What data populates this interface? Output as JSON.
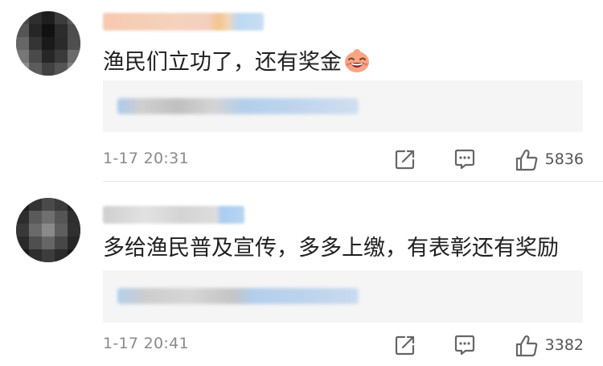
{
  "comments": [
    {
      "text": "渔民们立功了，还有奖金",
      "reply_summary": "共70条回复",
      "time": "1-17 20:31",
      "likes": "5836",
      "has_emoji": true,
      "avatar_tones": [
        "#4a4a4a",
        "#2e2e2e",
        "#1e1e1e",
        "#3c3c3c",
        "#5a5a5a",
        "#555555",
        "#262626",
        "#111111",
        "#2c2c2c",
        "#4d4d4d",
        "#666666",
        "#343434",
        "#1a1a1a",
        "#2a2a2a",
        "#4f4f4f",
        "#777777",
        "#4a4a4a",
        "#262626",
        "#3a3a3a",
        "#6a6a6a",
        "#8c8c8c",
        "#5c5c5c",
        "#414141",
        "#555555",
        "#7e7e7e"
      ]
    },
    {
      "text": "多给渔民普及宣传，多多上缴，有表彰还有奖励",
      "reply_summary": "",
      "time": "1-17 20:41",
      "likes": "3382",
      "has_emoji": false,
      "avatar_tones": [
        "#1f1f1f",
        "#333333",
        "#4a4a4a",
        "#3a3a3a",
        "#222222",
        "#2d2d2d",
        "#5a5a5a",
        "#6f6f6f",
        "#555555",
        "#2e2e2e",
        "#383838",
        "#6a6a6a",
        "#8a8a8a",
        "#5e5e5e",
        "#303030",
        "#2a2a2a",
        "#4f4f4f",
        "#666666",
        "#474747",
        "#272727",
        "#1c1c1c",
        "#2e2e2e",
        "#3d3d3d",
        "#2b2b2b",
        "#1a1a1a"
      ]
    }
  ],
  "icons": {
    "repost": "repost-icon",
    "reply": "comment-icon",
    "like": "thumbs-up-icon",
    "emoji": "laughing-face-emoji"
  },
  "colors": {
    "text": "#1f1f1f",
    "meta": "#8a8a8a",
    "icon": "#666666",
    "reply_box": "#f5f5f5"
  }
}
